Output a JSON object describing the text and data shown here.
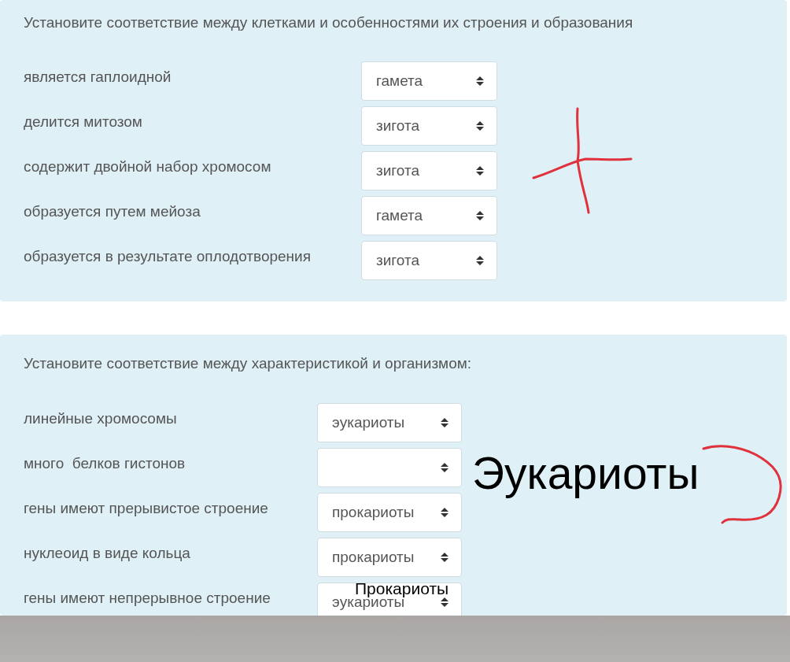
{
  "questions": [
    {
      "prompt": "Установите соответствие между клетками и особенностями их строения и образования",
      "rows": [
        {
          "label": "является гаплоидной",
          "value": "гамета"
        },
        {
          "label": "делится митозом",
          "value": "зигота"
        },
        {
          "label": "содержит двойной набор хромосом",
          "value": "зигота"
        },
        {
          "label": "образуется путем мейоза",
          "value": "гамета"
        },
        {
          "label": "образуется в результате оплодотворения",
          "value": "зигота"
        }
      ]
    },
    {
      "prompt": "Установите соответствие между характеристикой и организмом:",
      "rows": [
        {
          "label": "линейные хромосомы",
          "value": "эукариоты"
        },
        {
          "label": "много  белков гистонов"
        },
        {
          "label": "гены имеют прерывистое строение",
          "value": "прокариоты"
        },
        {
          "label": "нуклеоид в виде кольца",
          "value": "прокариоты"
        },
        {
          "label": "гены имеют непрерывное строение",
          "value": "эукариоты"
        }
      ]
    }
  ],
  "annotations": [
    {
      "kind": "cross"
    },
    {
      "kind": "bracket"
    },
    {
      "kind": "big_text",
      "text": "Эукариоты"
    },
    {
      "kind": "small_text",
      "text": "Прокариоты"
    }
  ]
}
